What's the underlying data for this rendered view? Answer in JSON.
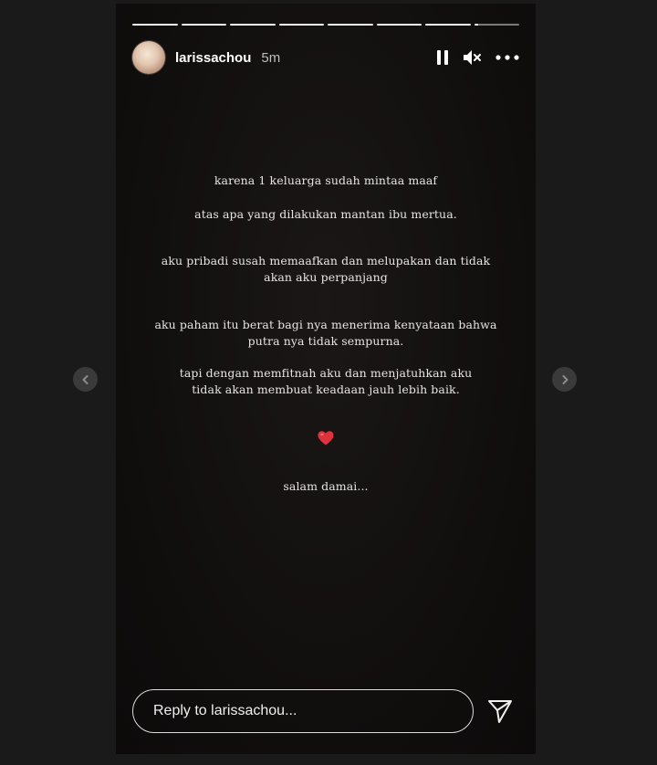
{
  "story": {
    "username": "larissachou",
    "time": "5m",
    "progress_segments": 8,
    "current_segment": 8,
    "current_segment_progress": 0.08
  },
  "controls": {
    "pause_icon": "pause-icon",
    "mute_icon": "muted-speaker-icon",
    "more_icon": "more-horizontal-icon"
  },
  "caption": {
    "line1": "karena 1 keluarga sudah mintaa maaf",
    "line2": "atas apa yang dilakukan mantan ibu mertua.",
    "line3": "aku pribadi susah memaafkan dan melupakan dan tidak\nakan aku perpanjang",
    "line4": "aku paham itu berat bagi nya menerima kenyataan bahwa\nputra nya tidak sempurna.",
    "line5": "tapi dengan memfitnah aku dan menjatuhkan aku\ntidak akan membuat keadaan jauh lebih baik.",
    "emoji": "red-heart",
    "line6": "salam damai..."
  },
  "reply": {
    "placeholder": "Reply to larissachou..."
  },
  "nav": {
    "prev_icon": "chevron-left-icon",
    "next_icon": "chevron-right-icon"
  },
  "colors": {
    "page_bg": "#1a1a1a",
    "story_bg": "#100d0d",
    "heart": "#e0323c"
  }
}
